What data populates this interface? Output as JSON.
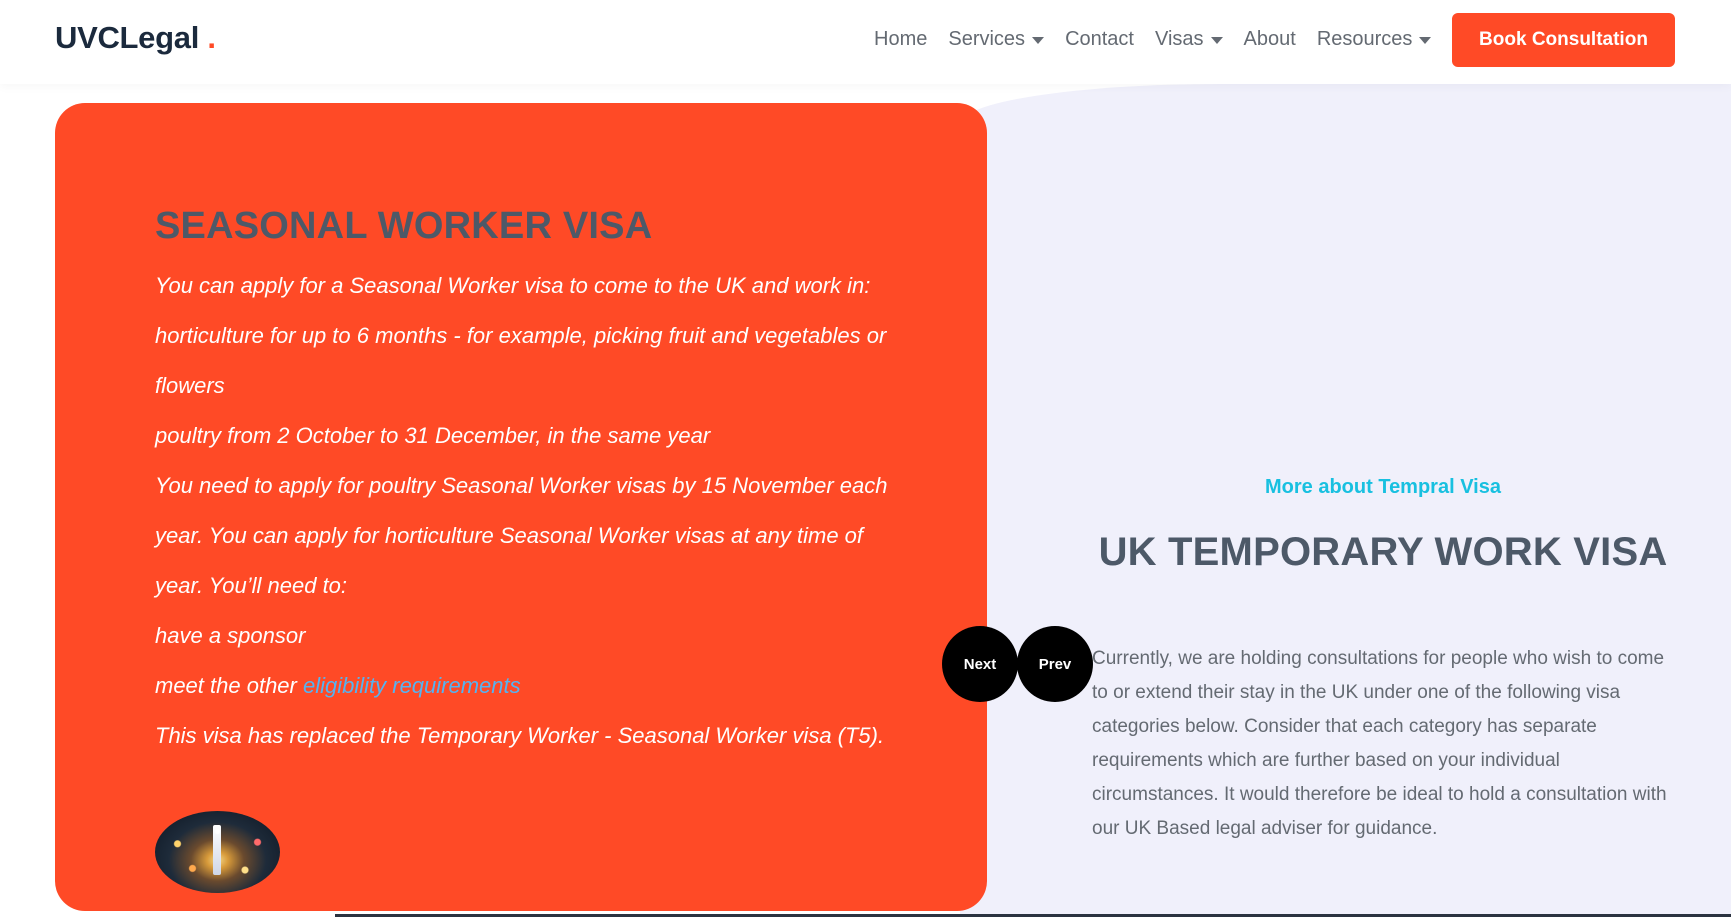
{
  "header": {
    "logo": {
      "text": "UVCLegal",
      "dot": "."
    },
    "nav": [
      {
        "label": "Home",
        "dropdown": false
      },
      {
        "label": "Services",
        "dropdown": true
      },
      {
        "label": "Contact",
        "dropdown": false
      },
      {
        "label": "Visas",
        "dropdown": true
      },
      {
        "label": "About",
        "dropdown": false
      },
      {
        "label": "Resources",
        "dropdown": true
      }
    ],
    "cta_label": "Book Consultation"
  },
  "card": {
    "title": "SEASONAL WORKER VISA",
    "lines": [
      "You can apply for a Seasonal Worker visa to come to the UK and work in:",
      "horticulture for up to 6 months - for example, picking fruit and vegetables or",
      "flowers",
      "poultry from 2 October to 31 December, in the same year",
      "You need to apply for poultry Seasonal Worker visas by 15 November each",
      "year. You can apply for horticulture Seasonal Worker visas at any time of",
      "year. You’ll need to:",
      "have a sponsor"
    ],
    "eligibility_prefix": "meet the other ",
    "eligibility_link": "eligibility requirements",
    "final_line": "This visa has replaced the Temporary Worker - Seasonal Worker visa (T5)."
  },
  "slider": {
    "next_label": "Next",
    "prev_label": "Prev"
  },
  "right": {
    "eyebrow": "More about Tempral Visa",
    "title": "UK TEMPORARY WORK VISA",
    "paragraph": "Currently, we are holding consultations for people who wish to come to or extend their stay in the UK under one of the following visa categories below. Consider that each category has separate requirements which are further based on your individual circumstances. It would therefore be ideal to hold a consultation with our UK Based legal adviser for guidance."
  },
  "colors": {
    "accent": "#ff4a26",
    "heading": "#4d5968",
    "eyebrow": "#18c0e0",
    "link": "#56b3f0",
    "right_background": "#f0f0fb"
  }
}
